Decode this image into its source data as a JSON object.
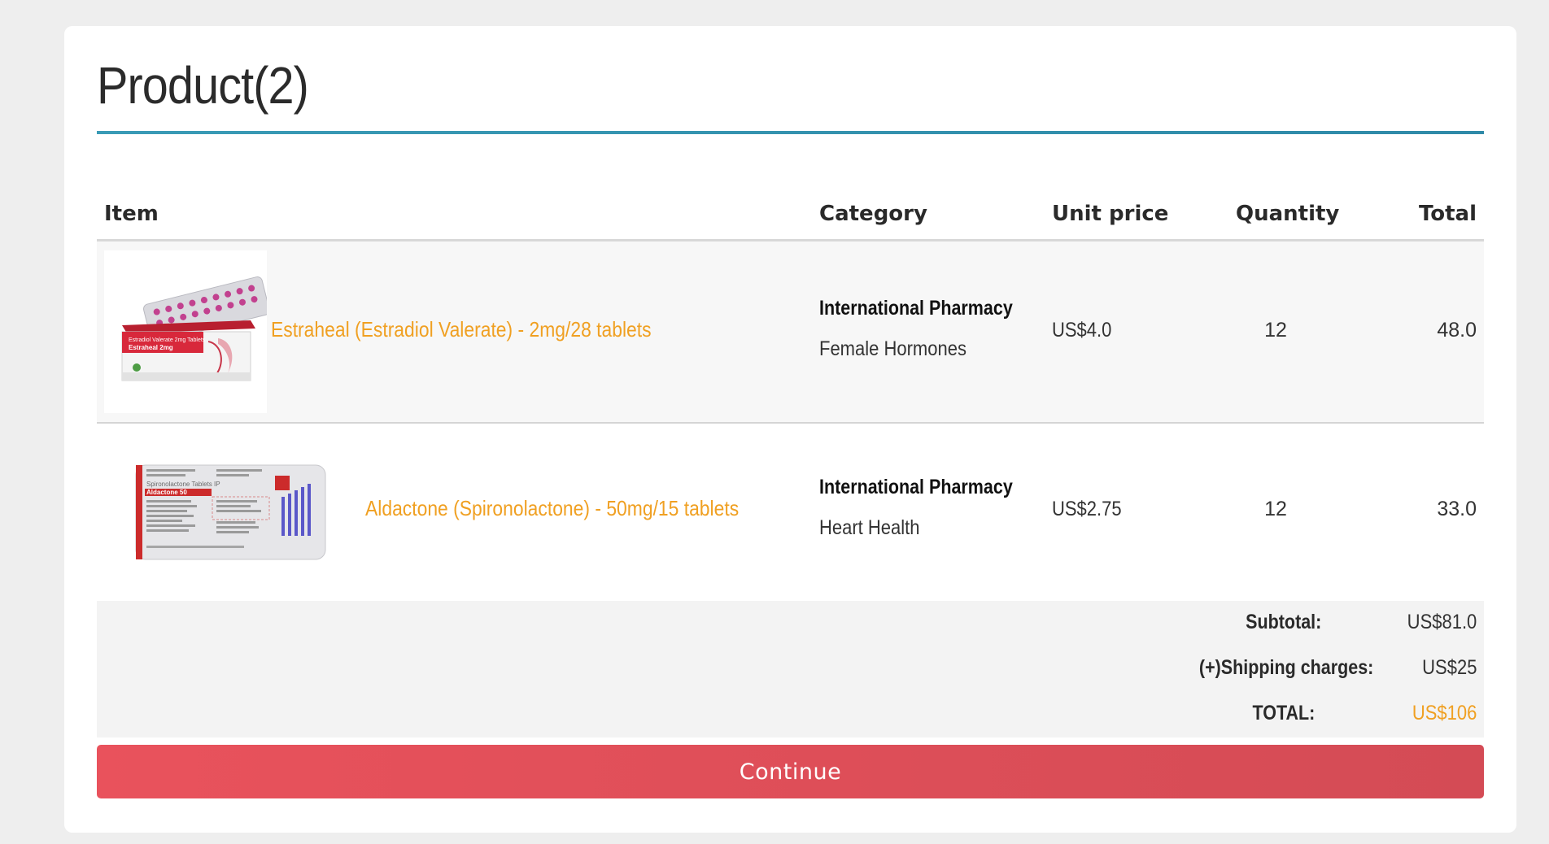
{
  "page": {
    "title": "Product(2)"
  },
  "table": {
    "headers": {
      "item": "Item",
      "category": "Category",
      "unit_price": "Unit price",
      "quantity": "Quantity",
      "total": "Total"
    },
    "rows": [
      {
        "product": "Estraheal (Estradiol Valerate) - 2mg/28 tablets",
        "vendor": "International Pharmacy",
        "category": "Female Hormones",
        "unit_price": "US$4.0",
        "quantity": "12",
        "total": "48.0",
        "image_icon": "pill-box-image",
        "image_text": "Estradiol Valerate 2mg Tablets Estraheal 2mg"
      },
      {
        "product": "Aldactone (Spironolactone) - 50mg/15 tablets",
        "vendor": "International Pharmacy",
        "category": "Heart Health",
        "unit_price": "US$2.75",
        "quantity": "12",
        "total": "33.0",
        "image_icon": "blister-pack-image",
        "image_text": "Spironolactone Tablets IP Aldactone 50"
      }
    ]
  },
  "summary": {
    "subtotal_label": "Subtotal:",
    "subtotal_value": "US$81.0",
    "shipping_label": "(+)Shipping charges:",
    "shipping_value": "US$25",
    "total_label": "TOTAL:",
    "total_value": "US$106"
  },
  "actions": {
    "continue_label": "Continue"
  },
  "colors": {
    "accent_orange": "#f0a022",
    "rule_teal": "#3a9bb6",
    "button_red": "#e9525c"
  }
}
